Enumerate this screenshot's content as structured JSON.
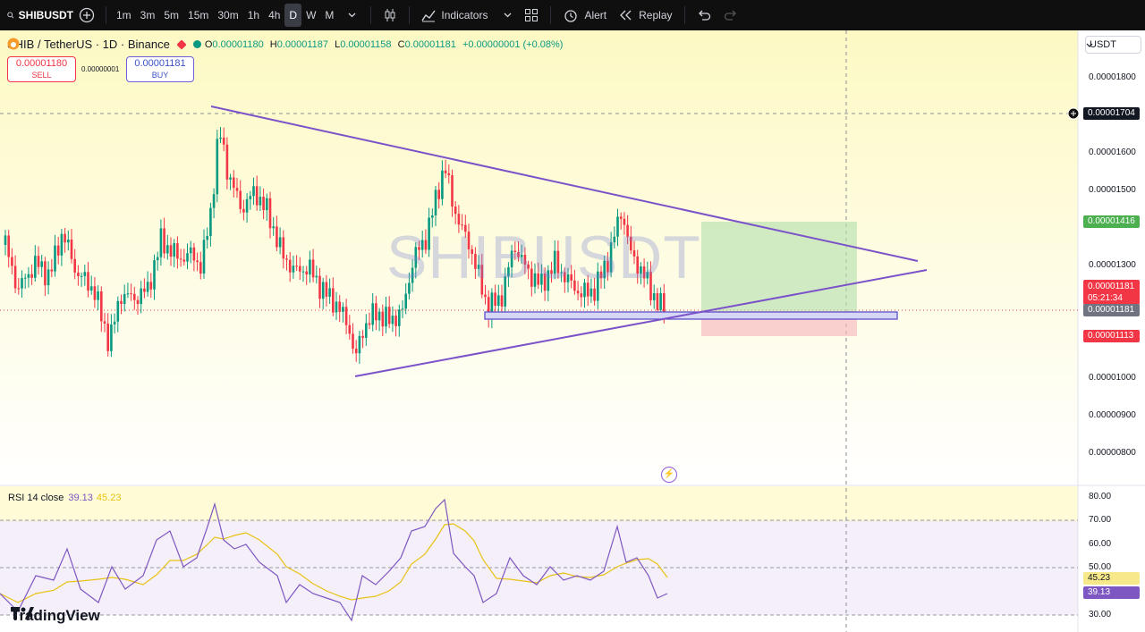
{
  "toolbar": {
    "symbol": "SHIBUSDT",
    "intervals": [
      "1m",
      "3m",
      "5m",
      "15m",
      "30m",
      "1h",
      "4h",
      "D",
      "W",
      "M"
    ],
    "active_interval": "D",
    "indicators_label": "Indicators",
    "alert_label": "Alert",
    "replay_label": "Replay"
  },
  "legend": {
    "title": "SHIB / TetherUS · 1D · Binance",
    "open_label": "O",
    "open": "0.00001180",
    "high_label": "H",
    "high": "0.00001187",
    "low_label": "L",
    "low": "0.00001158",
    "close_label": "C",
    "close": "0.00001181",
    "change": "+0.00000001 (+0.08%)"
  },
  "trade": {
    "sell_price": "0.00001180",
    "sell_label": "SELL",
    "spread": "0.00000001",
    "buy_price": "0.00001181",
    "buy_label": "BUY"
  },
  "currency": "USDT",
  "watermark": "SHIBUSDT",
  "price_axis": [
    "0.00001800",
    "0.00001600",
    "0.00001500",
    "0.00001300",
    "0.00001000",
    "0.00000900",
    "0.00000800"
  ],
  "price_tags": {
    "crosshair": "0.00001704",
    "target": "0.00001416",
    "last_price": "0.00001181",
    "countdown": "05:21:34",
    "last_price_2": "0.00001181",
    "stop": "0.00001113"
  },
  "rsi": {
    "label": "RSI 14 close",
    "value": "39.13",
    "ma_value": "45.23",
    "axis": [
      "80.00",
      "70.00",
      "60.00",
      "50.00",
      "30.00"
    ],
    "tag_value": "45.23",
    "tag_rsi": "39.13"
  },
  "colors": {
    "up": "#089981",
    "down": "#f23645",
    "trend": "#7b52c9",
    "target_zone": "#c8e6c9",
    "stop_zone": "#f8c4c8",
    "rsi": "#7e57c2",
    "rsi_ma": "#e8c316"
  },
  "brand": "TradingView"
}
